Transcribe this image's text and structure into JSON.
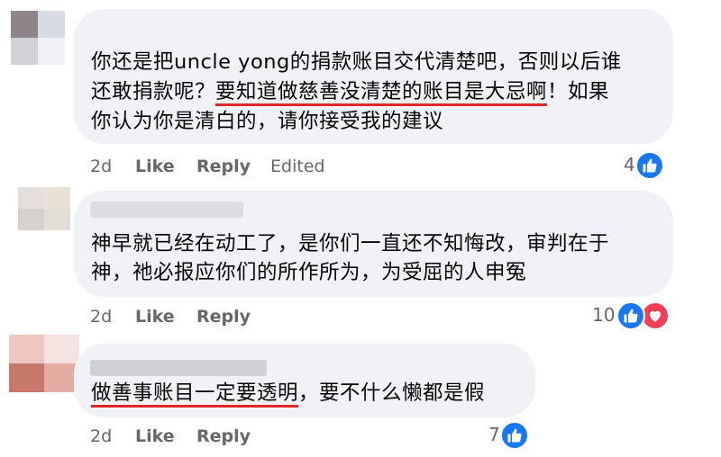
{
  "comments": [
    {
      "lines": [
        [
          {
            "t": "你还是把uncle yong的捐款账目交代清楚吧，否则以后谁",
            "u": false
          }
        ],
        [
          {
            "t": "还敢捐款呢？",
            "u": false
          },
          {
            "t": "要知道做慈善没清楚的账目是大忌啊",
            "u": true
          },
          {
            "t": "！如果",
            "u": false
          }
        ],
        [
          {
            "t": "你认为你是清白的，请你接受我的建议",
            "u": false
          }
        ]
      ],
      "time": "2d",
      "like": "Like",
      "reply": "Reply",
      "edited": "Edited",
      "reaction_count": "4"
    },
    {
      "lines": [
        [
          {
            "t": "神早就已经在动工了，是你们一直还不知悔改，审判在于",
            "u": false
          }
        ],
        [
          {
            "t": "神，祂必报应你们的所作所为，为受屈的人申冤",
            "u": false
          }
        ]
      ],
      "time": "2d",
      "like": "Like",
      "reply": "Reply",
      "reaction_count": "10"
    },
    {
      "lines": [
        [
          {
            "t": "做善事账目一定要透明",
            "u": true
          },
          {
            "t": "，要不什么懒都是假",
            "u": false
          }
        ]
      ],
      "time": "2d",
      "like": "Like",
      "reply": "Reply",
      "reaction_count": "7"
    }
  ],
  "icons": {
    "like": "thumbs-up-icon",
    "love": "heart-icon"
  },
  "colors": {
    "bubble": "#f0f2f5",
    "meta_text": "#65676b",
    "like_blue": "#1877f2",
    "love_red": "#f33e58",
    "underline": "#e4262c"
  }
}
